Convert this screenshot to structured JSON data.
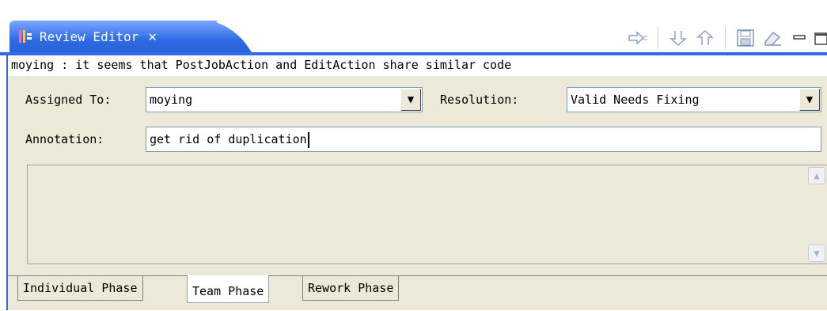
{
  "tab": {
    "title": "Review Editor",
    "close_glyph": "✕",
    "icon": "review-editor-icon"
  },
  "toolbar": {
    "items": [
      {
        "name": "filter-arrow-icon"
      },
      {
        "name": "next-down-icon"
      },
      {
        "name": "previous-up-icon"
      },
      {
        "name": "save-icon"
      },
      {
        "name": "eraser-icon"
      },
      {
        "name": "minimize-icon"
      },
      {
        "name": "maximize-icon"
      }
    ]
  },
  "comment": "moying : it seems that PostJobAction and EditAction share similar code",
  "form": {
    "assigned_label": "Assigned To:",
    "assigned_value": "moying",
    "resolution_label": "Resolution:",
    "resolution_value": "Valid Needs Fixing",
    "annotation_label": "Annotation:",
    "annotation_value": "get rid of duplication"
  },
  "bottom_tabs": [
    {
      "label": "Individual Phase",
      "active": false
    },
    {
      "label": "Team Phase",
      "active": true
    },
    {
      "label": "Rework Phase",
      "active": false
    }
  ],
  "colors": {
    "accent": "#2f6be4",
    "panel": "#ece9d8"
  }
}
